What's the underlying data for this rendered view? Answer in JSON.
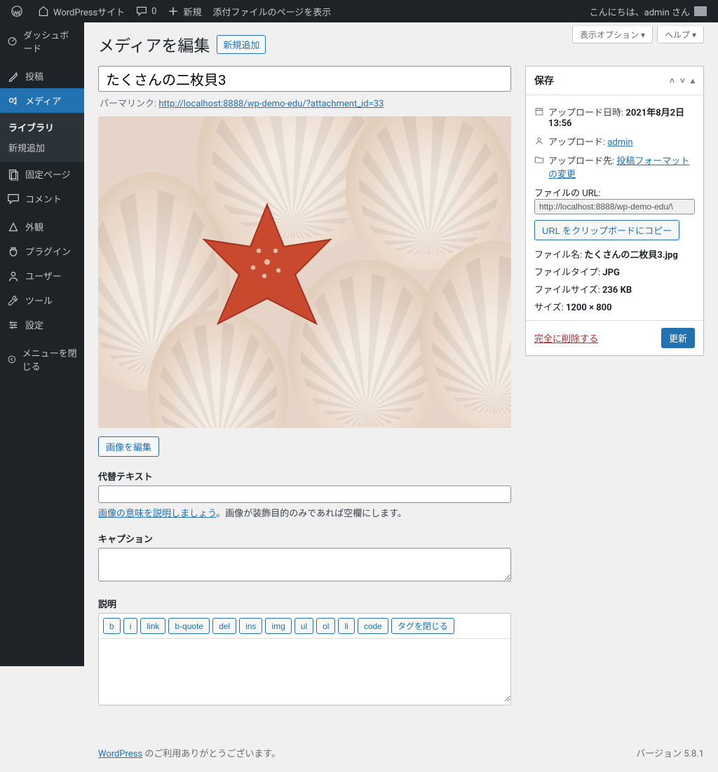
{
  "adminbar": {
    "site_name": "WordPressサイト",
    "comments": "0",
    "new": "新規",
    "view": "添付ファイルのページを表示",
    "greeting": "こんにちは、admin さん"
  },
  "sidebar": {
    "items": [
      {
        "label": "ダッシュボード"
      },
      {
        "label": "投稿"
      },
      {
        "label": "メディア"
      },
      {
        "label": "固定ページ"
      },
      {
        "label": "コメント"
      },
      {
        "label": "外観"
      },
      {
        "label": "プラグイン"
      },
      {
        "label": "ユーザー"
      },
      {
        "label": "ツール"
      },
      {
        "label": "設定"
      },
      {
        "label": "メニューを閉じる"
      }
    ],
    "submenu": {
      "library": "ライブラリ",
      "add_new": "新規追加"
    }
  },
  "screen_meta": {
    "options": "表示オプション ▾",
    "help": "ヘルプ ▾"
  },
  "page": {
    "heading": "メディアを編集",
    "add_new": "新規追加",
    "title_value": "たくさんの二枚貝3",
    "permalink_label": "パーマリンク:",
    "permalink_url": "http://localhost:8888/wp-demo-edu/?attachment_id=33",
    "edit_image": "画像を編集",
    "alt_label": "代替テキスト",
    "alt_help_link": "画像の意味を説明しましょう",
    "alt_help_text": "。画像が装飾目的のみであれば空欄にします。",
    "caption_label": "キャプション",
    "desc_label": "説明"
  },
  "quicktags": [
    "b",
    "i",
    "link",
    "b-quote",
    "del",
    "ins",
    "img",
    "ul",
    "ol",
    "li",
    "code",
    "タグを閉じる"
  ],
  "savebox": {
    "title": "保存",
    "uploaded_on_label": "アップロード日時:",
    "uploaded_on": "2021年8月2日 13:56",
    "uploaded_by_label": "アップロード:",
    "uploaded_by": "admin",
    "uploaded_to_label": "アップロード先:",
    "uploaded_to": "投稿フォーマットの変更",
    "file_url_label": "ファイルの URL:",
    "file_url": "http://localhost:8888/wp-demo-edu/\\",
    "copy_url": "URL をクリップボードにコピー",
    "file_name_label": "ファイル名:",
    "file_name": "たくさんの二枚貝3.jpg",
    "file_type_label": "ファイルタイプ:",
    "file_type": "JPG",
    "file_size_label": "ファイルサイズ:",
    "file_size": "236 KB",
    "dimensions_label": "サイズ:",
    "dimensions": "1200 × 800",
    "delete": "完全に削除する",
    "update": "更新"
  },
  "footer": {
    "wp_link": "WordPress",
    "thanks": " のご利用ありがとうございます。",
    "version": "バージョン 5.8.1"
  }
}
